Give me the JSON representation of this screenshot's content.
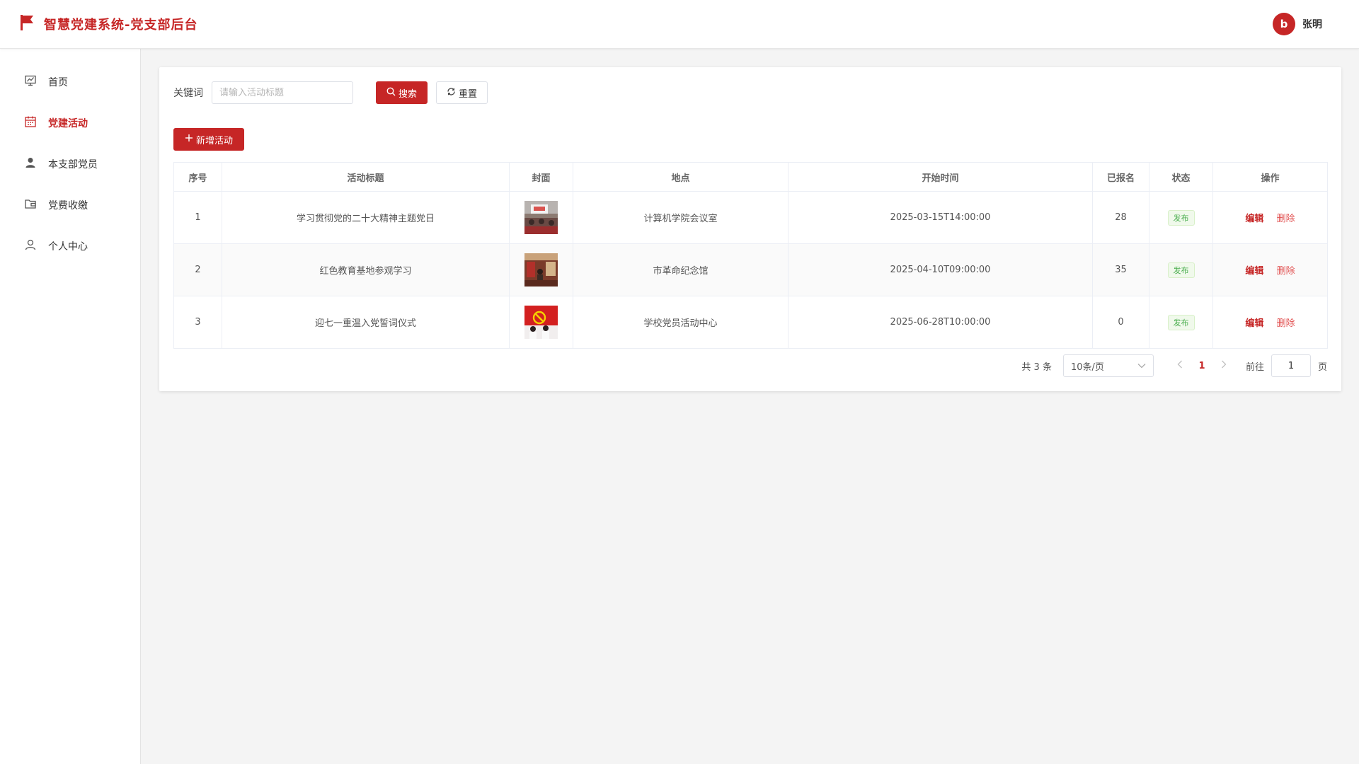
{
  "header": {
    "title": "智慧党建系统-党支部后台",
    "avatar_letter": "b",
    "user_name": "张明"
  },
  "sidebar": {
    "items": [
      {
        "label": "首页",
        "icon": "chart-board-icon",
        "active": false
      },
      {
        "label": "党建活动",
        "icon": "calendar-icon",
        "active": true
      },
      {
        "label": "本支部党员",
        "icon": "user-solid-icon",
        "active": false
      },
      {
        "label": "党费收缴",
        "icon": "wallet-folder-icon",
        "active": false
      },
      {
        "label": "个人中心",
        "icon": "user-outline-icon",
        "active": false
      }
    ]
  },
  "search": {
    "label": "关键词",
    "placeholder": "请输入活动标题",
    "value": "",
    "search_button": "搜索",
    "reset_button": "重置"
  },
  "toolbar": {
    "add_button": "新增活动"
  },
  "table": {
    "columns": [
      "序号",
      "活动标题",
      "封面",
      "地点",
      "开始时间",
      "已报名",
      "状态",
      "操作"
    ],
    "rows": [
      {
        "index": "1",
        "title": "学习贯彻党的二十大精神主题党日",
        "cover": "meeting-room-photo",
        "location": "计算机学院会议室",
        "start_time": "2025-03-15T14:00:00",
        "enrolled": "28",
        "status": "发布",
        "edit": "编辑",
        "delete": "删除"
      },
      {
        "index": "2",
        "title": "红色教育基地参观学习",
        "cover": "exhibition-hall-photo",
        "location": "市革命纪念馆",
        "start_time": "2025-04-10T09:00:00",
        "enrolled": "35",
        "status": "发布",
        "edit": "编辑",
        "delete": "删除"
      },
      {
        "index": "3",
        "title": "迎七一重温入党誓词仪式",
        "cover": "party-flag-oath-photo",
        "location": "学校党员活动中心",
        "start_time": "2025-06-28T10:00:00",
        "enrolled": "0",
        "status": "发布",
        "edit": "编辑",
        "delete": "删除"
      }
    ]
  },
  "pagination": {
    "total": "共 3 条",
    "page_size": "10条/页",
    "current_page": "1",
    "goto_label": "前往",
    "goto_value": "1",
    "goto_suffix": "页"
  },
  "colors": {
    "accent": "#c62626",
    "status_green": "#4caf50",
    "background": "#f4f4f4"
  }
}
